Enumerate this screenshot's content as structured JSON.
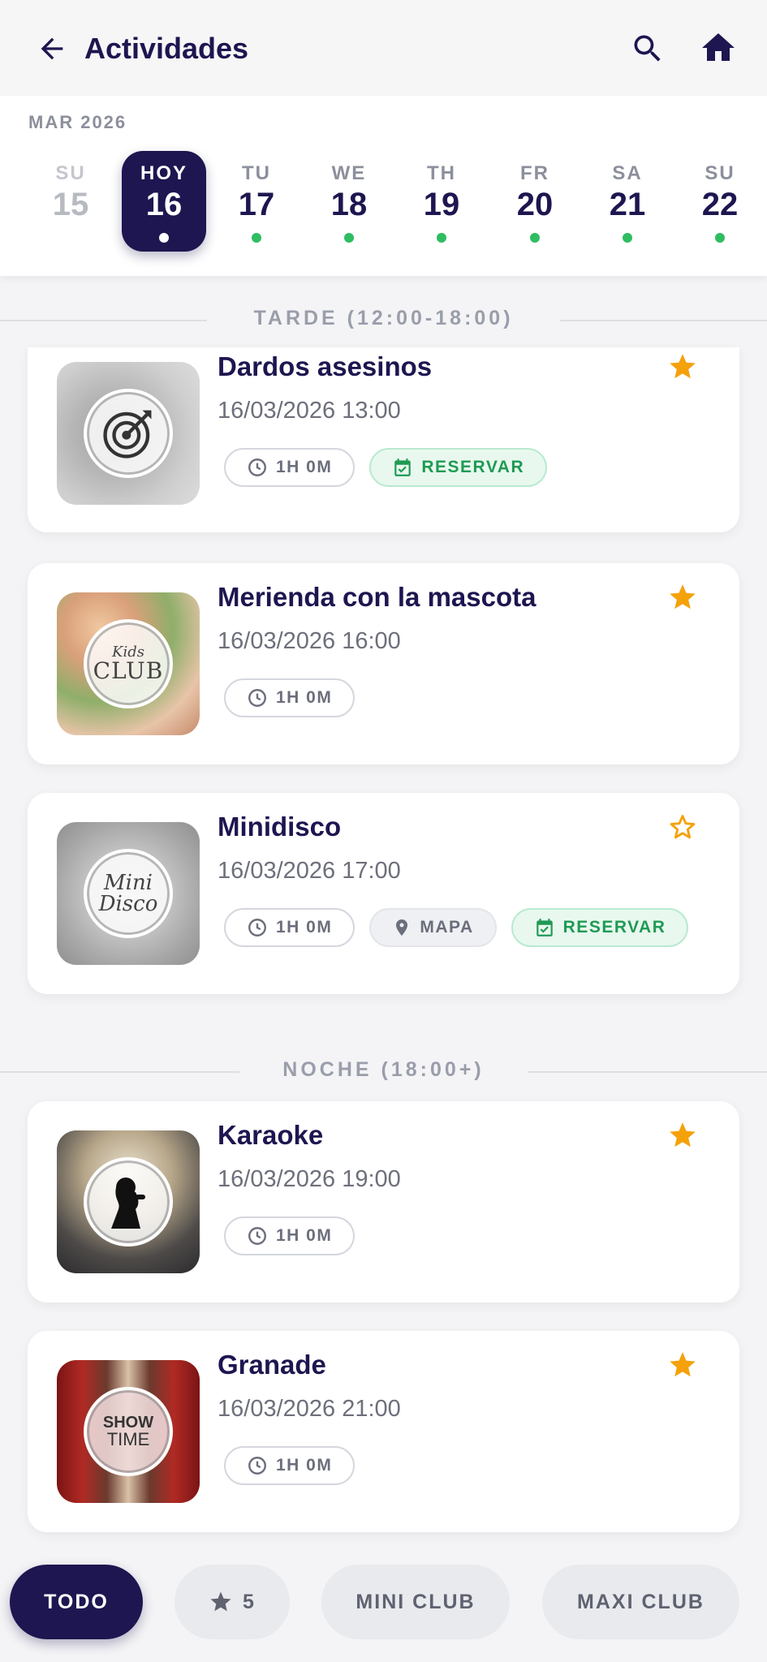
{
  "header": {
    "title": "Actividades",
    "back_icon": "arrow-left-icon",
    "search_icon": "search-icon",
    "home_icon": "home-icon"
  },
  "calendar": {
    "month": "MAR 2026",
    "days": [
      {
        "name": "SU",
        "num": "15",
        "state": "past",
        "has_events": false
      },
      {
        "name": "HOY",
        "num": "16",
        "state": "today",
        "has_events": true
      },
      {
        "name": "TU",
        "num": "17",
        "state": "future",
        "has_events": true
      },
      {
        "name": "WE",
        "num": "18",
        "state": "future",
        "has_events": true
      },
      {
        "name": "TH",
        "num": "19",
        "state": "future",
        "has_events": true
      },
      {
        "name": "FR",
        "num": "20",
        "state": "future",
        "has_events": true
      },
      {
        "name": "SA",
        "num": "21",
        "state": "future",
        "has_events": true
      },
      {
        "name": "SU",
        "num": "22",
        "state": "future",
        "has_events": true
      }
    ]
  },
  "sections": {
    "tarde": "TARDE (12:00-18:00)",
    "noche": "NOCHE (18:00+)"
  },
  "activities": [
    {
      "title": "Dardos asesinos",
      "datetime": "16/03/2026 13:00",
      "duration": "1H 0M",
      "favorite": true,
      "map": false,
      "reserve": true,
      "reserve_label": "RESERVAR",
      "thumb_icon": "darts-target-icon"
    },
    {
      "title": "Merienda con la mascota",
      "datetime": "16/03/2026 16:00",
      "duration": "1H 0M",
      "favorite": true,
      "map": false,
      "reserve": false,
      "thumb_badge_top": "Kids",
      "thumb_badge_bottom": "CLUB"
    },
    {
      "title": "Minidisco",
      "datetime": "16/03/2026 17:00",
      "duration": "1H 0M",
      "favorite": false,
      "map": true,
      "map_label": "MAPA",
      "reserve": true,
      "reserve_label": "RESERVAR",
      "thumb_badge_top": "Mini",
      "thumb_badge_bottom": "Disco"
    },
    {
      "title": "Karaoke",
      "datetime": "16/03/2026 19:00",
      "duration": "1H 0M",
      "favorite": true,
      "map": false,
      "reserve": false,
      "thumb_icon": "singer-silhouette-icon"
    },
    {
      "title": "Granade",
      "datetime": "16/03/2026 21:00",
      "duration": "1H 0M",
      "favorite": true,
      "map": false,
      "reserve": false,
      "thumb_badge_top": "SHOW",
      "thumb_badge_bottom": "TIME"
    }
  ],
  "filters": {
    "todo": "TODO",
    "favorites_count": "5",
    "mini_club": "MINI CLUB",
    "maxi_club": "MAXI CLUB"
  },
  "colors": {
    "primary": "#1d1650",
    "star": "#f5a10a",
    "event_dot": "#2ebd62",
    "reserve_green": "#1f9a54"
  }
}
